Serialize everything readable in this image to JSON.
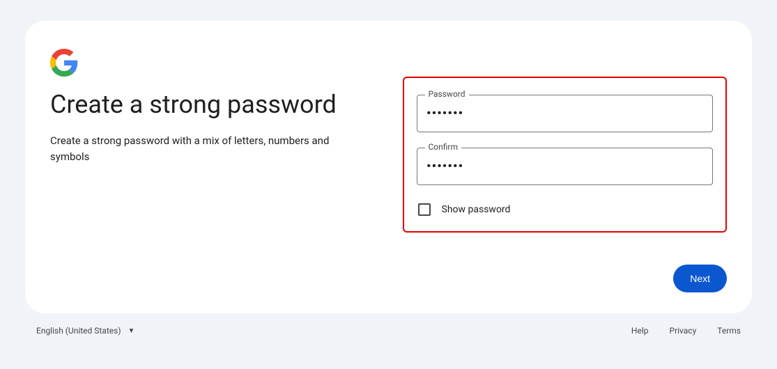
{
  "heading": "Create a strong password",
  "subtitle": "Create a strong password with a mix of letters, numbers and symbols",
  "fields": {
    "password": {
      "label": "Password",
      "value": "•••••••"
    },
    "confirm": {
      "label": "Confirm",
      "value": "•••••••"
    }
  },
  "show_password_label": "Show password",
  "next_label": "Next",
  "footer": {
    "language": "English (United States)",
    "help": "Help",
    "privacy": "Privacy",
    "terms": "Terms"
  }
}
